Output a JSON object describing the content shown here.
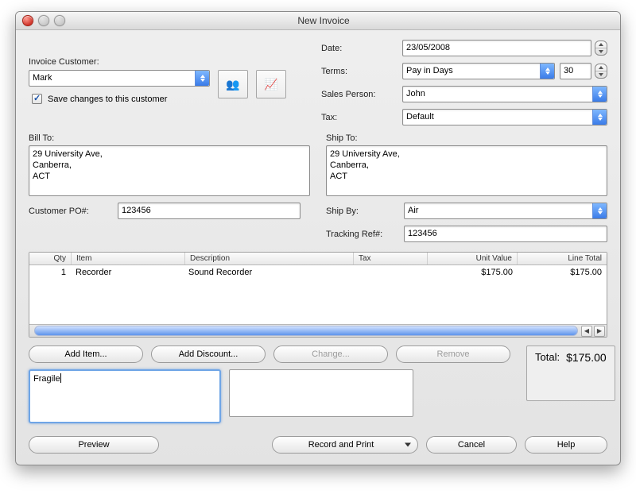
{
  "window": {
    "title": "New Invoice"
  },
  "header_right": {
    "date_label": "Date:",
    "date_value": "23/05/2008",
    "terms_label": "Terms:",
    "terms_value": "Pay in Days",
    "terms_days": "30",
    "sales_person_label": "Sales Person:",
    "sales_person_value": "John",
    "tax_label": "Tax:",
    "tax_value": "Default"
  },
  "customer_section": {
    "label": "Invoice Customer:",
    "name": "Mark",
    "save_changes_label": "Save changes to this customer",
    "save_changes_checked": true
  },
  "addresses": {
    "bill_to_label": "Bill To:",
    "bill_to_value": "29 University Ave,\nCanberra,\nACT",
    "ship_to_label": "Ship To:",
    "ship_to_value": "29 University Ave,\nCanberra,\nACT"
  },
  "po_section": {
    "po_label": "Customer PO#:",
    "po_value": "123456",
    "ship_by_label": "Ship By:",
    "ship_by_value": "Air",
    "tracking_label": "Tracking Ref#:",
    "tracking_value": "123456"
  },
  "table": {
    "headers": {
      "qty": "Qty",
      "item": "Item",
      "desc": "Description",
      "tax": "Tax",
      "uv": "Unit Value",
      "lt": "Line Total"
    },
    "rows": [
      {
        "qty": "1",
        "item": "Recorder",
        "desc": "Sound Recorder",
        "tax": "",
        "uv": "$175.00",
        "lt": "$175.00"
      }
    ]
  },
  "buttons": {
    "add_item": "Add Item...",
    "add_discount": "Add Discount...",
    "change": "Change...",
    "remove": "Remove",
    "preview": "Preview",
    "record_and_print": "Record and Print",
    "cancel": "Cancel",
    "help": "Help"
  },
  "notes": {
    "comment": "Fragile"
  },
  "totals": {
    "label": "Total:",
    "value": "$175.00"
  }
}
